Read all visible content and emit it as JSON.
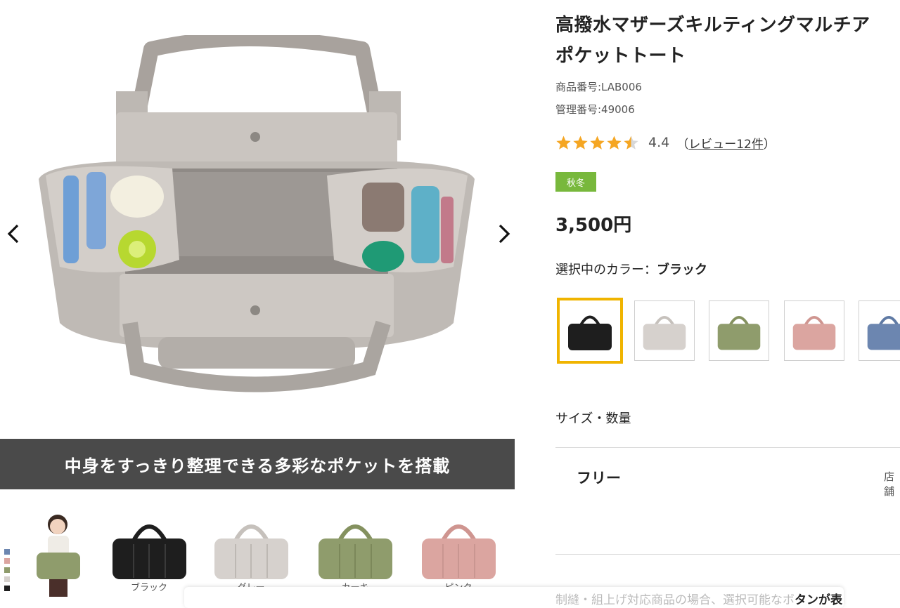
{
  "product": {
    "title_line1": "高撥水マザーズキルティングマルチア",
    "title_line2": "ポケットトート",
    "product_number": "商品番号:LAB006",
    "management_number": "管理番号:49006",
    "rating": {
      "value": "4.4",
      "review_prefix": "（",
      "review_link": "レビュー12件",
      "review_suffix": "）",
      "stars": 4.4
    },
    "season_badge": "秋冬",
    "price": "3,500円",
    "selected_color_label": "選択中のカラー：",
    "selected_color": "ブラック",
    "size_qty_label": "サイズ・数量",
    "size_option": "フリー",
    "store_text": "店舗"
  },
  "gallery": {
    "caption": "中身をすっきり整理できる多彩なポケットを搭載",
    "prev_icon": "chevron-left-icon",
    "next_icon": "chevron-right-icon",
    "strip_labels": [
      "ブラック",
      "グレー",
      "カーキ",
      "ピンク"
    ]
  },
  "colors": {
    "accent_selected": "#f0b400",
    "badge_green": "#78b83c",
    "caption_bg": "#4a4a4a",
    "star": "#f5a623",
    "swatches": [
      "#1e1e1e",
      "#d6d1cd",
      "#8f9c6c",
      "#dba5a0",
      "#6c86b0"
    ]
  },
  "footer": {
    "text": "制縫・組上げ対応商品の場合、選択可能なボ",
    "text_bold": "タンが表"
  }
}
